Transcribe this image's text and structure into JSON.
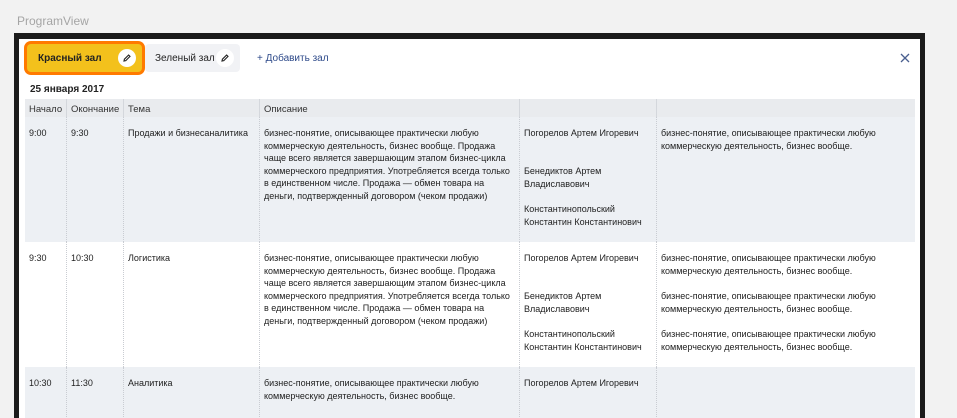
{
  "frame_title": "ProgramView",
  "tabs": [
    {
      "label": "Красный зал",
      "active": true
    },
    {
      "label": "Зеленый зал",
      "active": false
    }
  ],
  "add_hall_label": "+ Добавить зал",
  "date": "25 января 2017",
  "columns": {
    "start": "Начало",
    "end": "Окончание",
    "topic": "Тема",
    "description": "Описание"
  },
  "rows": [
    {
      "start": "9:00",
      "end": "9:30",
      "topic": "Продажи и бизнесаналитика",
      "description": "бизнес-понятие, описывающее практически любую коммерческую деятельность, бизнес вообще. Продажа чаще всего является завершающим этапом бизнес-цикла коммерческого предприятия. Употребляется всегда только в единственном числе. Продажа — обмен товара на деньги, подтвержденный договором (чеком продажи)",
      "speakers": [
        "Погорелов Артем Игоревич",
        "Бенедиктов Артем Владиславович",
        "Константинопольский Константин Константинович"
      ],
      "notes": [
        "бизнес-понятие, описывающее практически любую коммерческую деятельность, бизнес вообще.",
        "",
        ""
      ]
    },
    {
      "start": "9:30",
      "end": "10:30",
      "topic": "Логистика",
      "description": "бизнес-понятие, описывающее практически любую коммерческую деятельность, бизнес вообще. Продажа чаще всего является завершающим этапом бизнес-цикла коммерческого предприятия. Употребляется всегда только в единственном числе. Продажа — обмен товара на деньги, подтвержденный договором (чеком продажи)",
      "speakers": [
        "Погорелов Артем Игоревич",
        "Бенедиктов Артем Владиславович",
        "Константинопольский Константин Константинович"
      ],
      "notes": [
        "бизнес-понятие, описывающее практически любую коммерческую деятельность, бизнес вообще.",
        "бизнес-понятие, описывающее практически любую коммерческую деятельность, бизнес вообще.",
        "бизнес-понятие, описывающее практически любую коммерческую деятельность, бизнес вообще."
      ]
    },
    {
      "start": "10:30",
      "end": "11:30",
      "topic": "Аналитика",
      "description": "бизнес-понятие, описывающее практически любую коммерческую деятельность, бизнес вообще.",
      "speakers": [
        "Погорелов Артем Игоревич"
      ],
      "notes": [
        ""
      ]
    }
  ],
  "colors": {
    "accent": "#f3c11c",
    "highlight": "#ff7a00",
    "header_bg": "#e9ebee",
    "row_shade": "#edf0f4",
    "link": "#2e4a8a"
  }
}
